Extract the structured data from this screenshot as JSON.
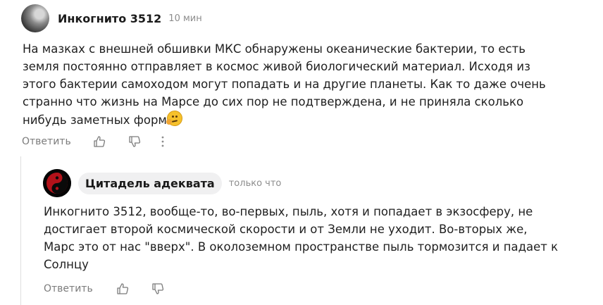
{
  "comments": [
    {
      "author": "Инкогнито 3512",
      "time": "10 мин",
      "text_lines": [
        "На мазках с внешней обшивки МКС обнаружены океанические бактерии, то есть",
        "земля постоянно отправляет в космос живой биологический материал. Исходя из",
        "этого бактерии самоходом могут попадать и на другие планеты. Как то даже очень",
        "странно что жизнь на Марсе до сих пор не подтверждена, и не приняла сколько",
        "нибудь заметных форм"
      ],
      "emoji": "thinking-face",
      "reply_label": "Ответить"
    },
    {
      "author": "Цитадель адеквата",
      "time": "только что",
      "text_lines": [
        "Инкогнито 3512, вообще-то, во-первых, пыль, хотя и попадает в экзосферу, не",
        "достигает второй космической скорости и от Земли не уходит. Во-вторых же,",
        "Марс это от нас \"вверх\". В околоземном пространстве пыль тормозится и падает к",
        "Солнцу"
      ],
      "reply_label": "Ответить"
    }
  ]
}
